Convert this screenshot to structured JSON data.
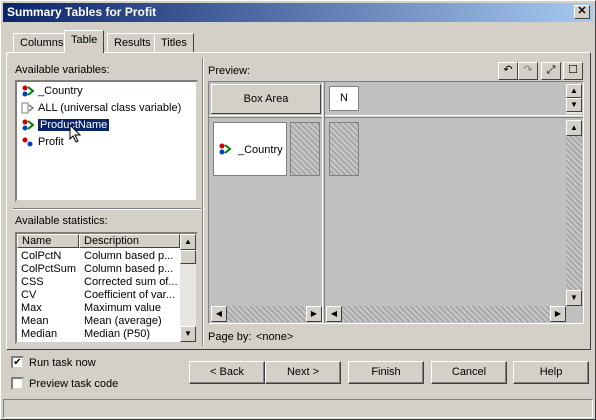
{
  "window": {
    "title": "Summary Tables for Profit",
    "close_label": "✕"
  },
  "tabs": [
    {
      "label": "Columns",
      "active": false
    },
    {
      "label": "Table",
      "active": true
    },
    {
      "label": "Results",
      "active": false
    },
    {
      "label": "Titles",
      "active": false
    }
  ],
  "variables": {
    "label": "Available variables:",
    "items": [
      {
        "label": "_Country",
        "icon": "classification-variable-icon"
      },
      {
        "label": "ALL (universal class variable)",
        "icon": "universal-class-icon"
      },
      {
        "label": "ProductName",
        "icon": "classification-variable-icon",
        "selected": true
      },
      {
        "label": "Profit",
        "icon": "analysis-variable-icon"
      }
    ]
  },
  "statistics": {
    "label": "Available statistics:",
    "columns": [
      "Name",
      "Description"
    ],
    "rows": [
      [
        "ColPctN",
        "Column based p..."
      ],
      [
        "ColPctSum",
        "Column based p..."
      ],
      [
        "CSS",
        "Corrected sum of..."
      ],
      [
        "CV",
        "Coefficient of var..."
      ],
      [
        "Max",
        "Maximum value"
      ],
      [
        "Mean",
        "Mean (average)"
      ],
      [
        "Median",
        "Median (P50)"
      ]
    ]
  },
  "preview": {
    "label": "Preview:",
    "box_area": "Box Area",
    "column_cell": "N",
    "row_cell": "_Country",
    "page_by_label": "Page by:",
    "page_by_value": "<none>"
  },
  "options": {
    "run_task_now": {
      "label": "Run task now",
      "checked": true
    },
    "preview_code": {
      "label": "Preview task code",
      "checked": false
    }
  },
  "buttons": {
    "back": "< Back",
    "next": "Next >",
    "finish": "Finish",
    "cancel": "Cancel",
    "help": "Help"
  }
}
